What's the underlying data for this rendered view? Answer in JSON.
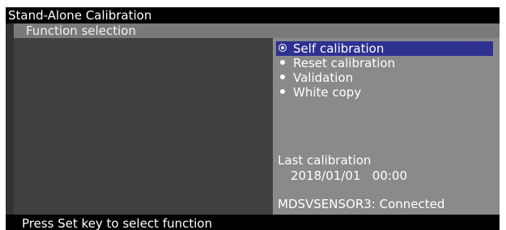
{
  "window": {
    "title": "Stand-Alone Calibration"
  },
  "section": {
    "title": "Function selection"
  },
  "menu": {
    "items": [
      {
        "label": "Self calibration",
        "selected": true
      },
      {
        "label": "Reset calibration",
        "selected": false
      },
      {
        "label": "Validation",
        "selected": false
      },
      {
        "label": "White copy",
        "selected": false
      }
    ]
  },
  "status": {
    "last_calibration_label": "Last calibration",
    "last_calibration_value": "2018/01/01   00:00",
    "sensor": "MDSVSENSOR3: Connected"
  },
  "footer": {
    "hint": "Press Set key to select function"
  },
  "colors": {
    "title_bar": "#000000",
    "section_header": "#7a7a7a",
    "left_pane": "#404040",
    "right_pane": "#8a8a8a",
    "selection_highlight": "#2e3192",
    "text": "#ffffff"
  },
  "icons": {
    "selected_marker": "radio-selected-icon",
    "unselected_marker": "bullet-icon"
  }
}
